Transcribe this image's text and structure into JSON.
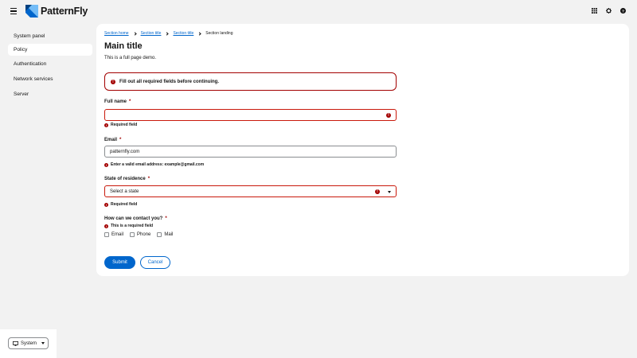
{
  "header": {
    "brand": "PatternFly",
    "icons": [
      "grid-icon",
      "gear-icon",
      "help-icon"
    ]
  },
  "sidebar": {
    "items": [
      {
        "label": "System panel",
        "active": false
      },
      {
        "label": "Policy",
        "active": true
      },
      {
        "label": "Authentication",
        "active": false
      },
      {
        "label": "Network services",
        "active": false
      },
      {
        "label": "Server",
        "active": false
      }
    ],
    "theme_select": "System"
  },
  "breadcrumb": {
    "items": [
      "Section home",
      "Section title",
      "Section title"
    ],
    "current": "Section landing"
  },
  "page": {
    "title": "Main title",
    "subtitle": "This is a full page demo."
  },
  "alert": {
    "text": "Fill out all required fields before continuing."
  },
  "form": {
    "full_name": {
      "label": "Full name",
      "required": "*",
      "value": "",
      "helper": "Required field"
    },
    "email": {
      "label": "Email",
      "required": "*",
      "value": "patternfly.com",
      "helper": "Enter a valid email address: example@gmail.com"
    },
    "state": {
      "label": "State of residence",
      "required": "*",
      "value": "Select a state",
      "helper": "Required field"
    },
    "contact": {
      "label": "How can we contact you?",
      "required": "*",
      "helper": "This is a required field",
      "options": [
        "Email",
        "Phone",
        "Mail"
      ]
    },
    "submit_label": "Submit",
    "cancel_label": "Cancel"
  },
  "colors": {
    "primary": "#0066cc",
    "danger": "#a30000",
    "danger_border": "#c9190b",
    "background": "#f2f2f2"
  }
}
